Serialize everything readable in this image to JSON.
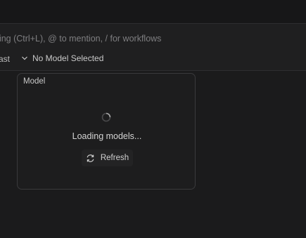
{
  "chat_input": {
    "placeholder_text": "hing (Ctrl+L), @ to mention, / for workflows"
  },
  "toolbar": {
    "mode_label": "ast",
    "model_selector_label": "No Model Selected"
  },
  "model_popup": {
    "title": "Model",
    "loading_text": "Loading models...",
    "refresh_label": "Refresh"
  },
  "icons": {
    "chevron": "chevron-down-icon",
    "spinner": "loading-spinner-icon",
    "refresh": "refresh-icon"
  },
  "colors": {
    "background": "#1b1b1c",
    "panel": "#1f1f20",
    "popup_border": "#3a3a3c",
    "placeholder": "#7e7e80"
  }
}
